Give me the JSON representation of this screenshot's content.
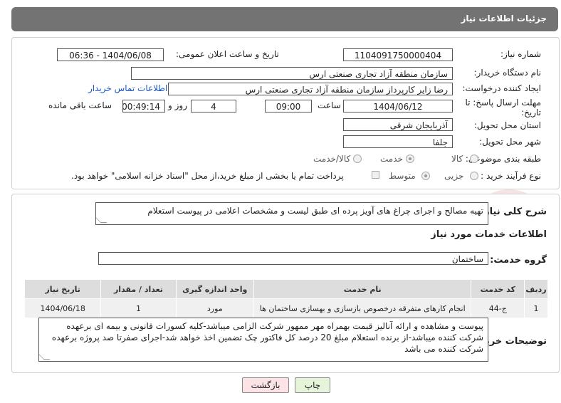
{
  "header": {
    "title": "جزئیات اطلاعات نیاز"
  },
  "form": {
    "need_number": {
      "label": "شماره نیاز:",
      "value": "1104091750000404"
    },
    "announce": {
      "label": "تاریخ و ساعت اعلان عمومی:",
      "value": "1404/06/08 - 06:36"
    },
    "buyer_org": {
      "label": "نام دستگاه خریدار:",
      "value": "سازمان منطقه آزاد تجاری صنعتی ارس"
    },
    "requester": {
      "label": "ایجاد کننده درخواست:",
      "value": "رضا زایر کارپرداز سازمان منطقه آزاد تجاری صنعتی ارس"
    },
    "contact_link": "اطلاعات تماس خریدار",
    "deadline": {
      "label_line1": "مهلت ارسال پاسخ: تا",
      "label_line2": "تاریخ:",
      "date": "1404/06/12",
      "time_label": "ساعت",
      "time": "09:00",
      "days": "4",
      "days_label": "روز و",
      "remaining": "00:49:14",
      "remaining_label": "ساعت باقی مانده"
    },
    "province": {
      "label": "استان محل تحویل:",
      "value": "آذربایجان شرقی"
    },
    "city": {
      "label": "شهر محل تحویل:",
      "value": "جلفا"
    },
    "category": {
      "label": "طبقه بندی موضوعی:",
      "options": [
        "کالا",
        "خدمت",
        "کالا/خدمت"
      ],
      "selected": "خدمت"
    },
    "process": {
      "label": "نوع فرآیند خرید :",
      "options": [
        "جزیی",
        "متوسط"
      ],
      "selected": "متوسط",
      "payment_note": "پرداخت تمام یا بخشی از مبلغ خرید،از محل \"اسناد خزانه اسلامی\" خواهد بود."
    }
  },
  "details": {
    "general_desc_label": "شرح کلی نیاز:",
    "general_desc": "تهیه مصالح و اجرای چراغ های آویز پرده ای طبق لیست و مشخصات اعلامی در پیوست استعلام",
    "services_title": "اطلاعات خدمات مورد نیاز",
    "service_group_label": "گروه خدمت:",
    "service_group": "ساختمان",
    "table": {
      "headers": [
        "ردیف",
        "کد خدمت",
        "نام خدمت",
        "واحد اندازه گیری",
        "تعداد / مقدار",
        "تاریخ نیاز"
      ],
      "rows": [
        [
          "1",
          "ج-44",
          "انجام کارهای متفرقه درخصوص بازسازی و بهسازی ساختمان ها",
          "مورد",
          "1",
          "1404/06/18"
        ]
      ]
    },
    "buyer_notes_label": "توضیحات خریدار:",
    "buyer_notes": "پیوست و مشاهده و ارائه آنالیز قیمت بهمراه مهر ممهور شرکت الزامی میباشد-کلیه کسورات قانونی و بیمه ای برعهده شرکت کننده میباشد-از برنده استعلام مبلغ 20 درصد کل فاکتور چک تضمین اخذ خواهد شد-اجرای صفرتا صد پروژه برعهده شرکت کننده می باشد"
  },
  "buttons": {
    "print": "چاپ",
    "back": "بازگشت"
  },
  "watermark_text": "AriaTender.neT",
  "colors": {
    "header_bg": "#737373",
    "print_btn": "#e6f5d9",
    "back_btn": "#fbe3e6",
    "link": "#1a55c4"
  }
}
